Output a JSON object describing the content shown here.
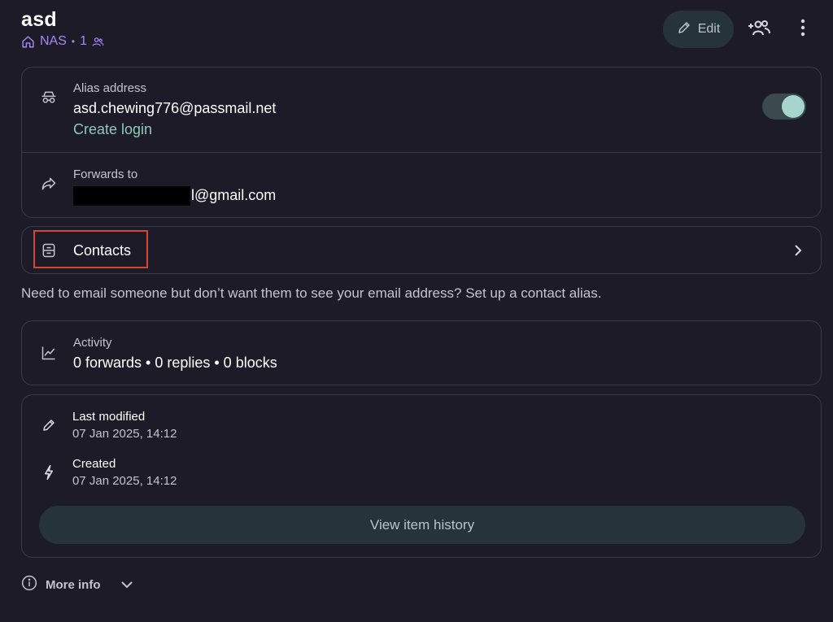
{
  "header": {
    "title": "asd",
    "vault_name": "NAS",
    "member_count": "1",
    "edit_label": "Edit"
  },
  "alias": {
    "label": "Alias address",
    "address": "asd.chewing776@passmail.net",
    "create_login_label": "Create login",
    "enabled": true
  },
  "forwards": {
    "label": "Forwards to",
    "address_suffix": "l@gmail.com"
  },
  "contacts": {
    "label": "Contacts"
  },
  "hint_text": "Need to email someone but don’t want them to see your email address? Set up a contact alias.",
  "activity": {
    "label": "Activity",
    "summary": "0 forwards • 0 replies • 0 blocks"
  },
  "history": {
    "last_modified_label": "Last modified",
    "last_modified_value": "07 Jan 2025, 14:12",
    "created_label": "Created",
    "created_value": "07 Jan 2025, 14:12",
    "view_history_label": "View item history"
  },
  "more_info_label": "More info",
  "icons": {
    "vault": "home-icon",
    "members": "people-icon",
    "edit": "pencil-icon",
    "share": "add-people-icon",
    "more": "vertical-dots-icon",
    "alias": "incognito-icon",
    "forwards": "forward-arrow-icon",
    "contacts": "contact-book-icon",
    "activity": "line-chart-icon",
    "modified": "pencil-icon",
    "created": "lightning-icon",
    "info": "info-circle-icon"
  },
  "colors": {
    "background": "#1c1b27",
    "vault_accent": "#a28dec",
    "link": "#8fc9bb",
    "highlight": "#d9442c",
    "toggle_knob": "#a6d6cb"
  }
}
